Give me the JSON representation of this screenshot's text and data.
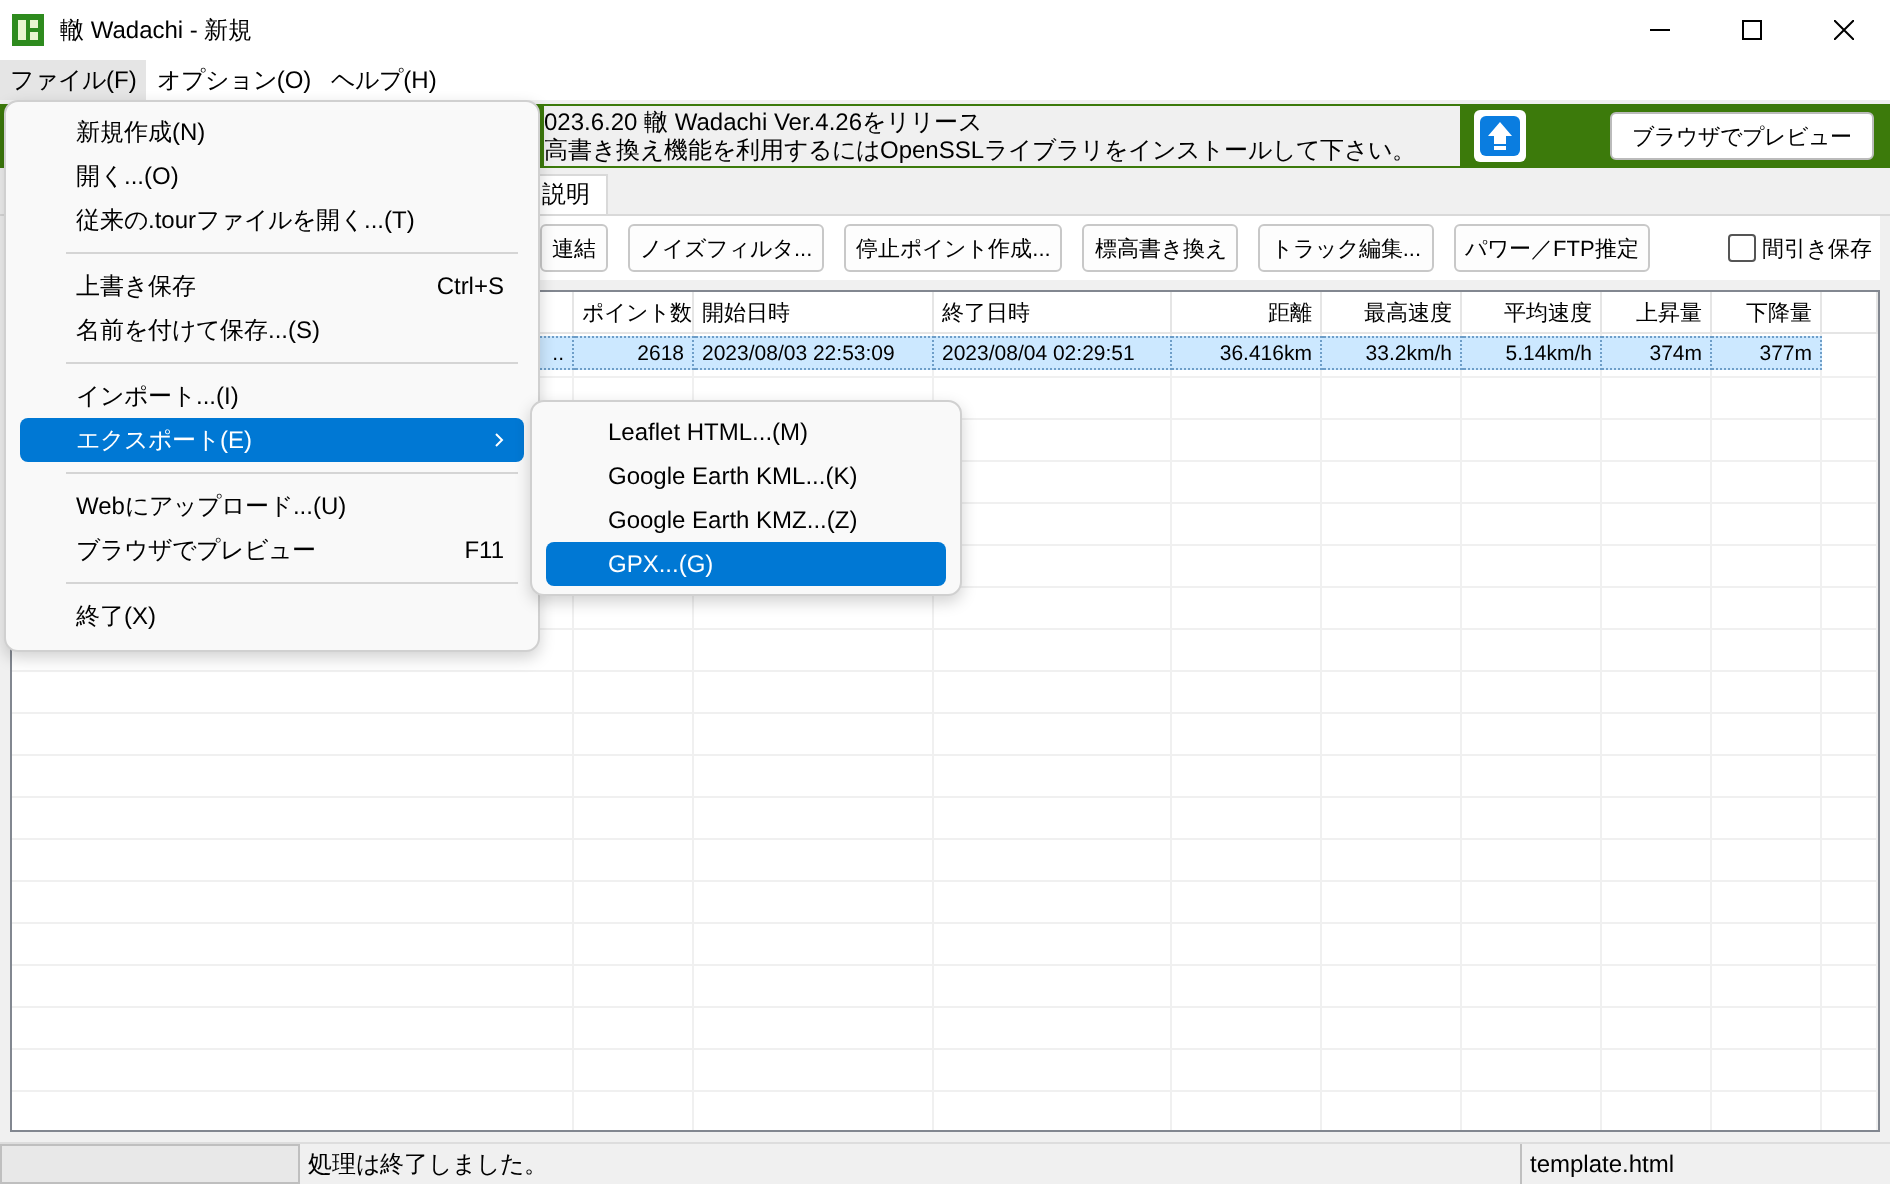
{
  "window": {
    "title": "轍 Wadachi - 新規"
  },
  "menubar": [
    {
      "label": "ファイル(F)",
      "selected": true
    },
    {
      "label": "オプション(O)",
      "selected": false
    },
    {
      "label": "ヘルプ(H)",
      "selected": false
    }
  ],
  "banner": {
    "lines": [
      "023.6.20 轍 Wadachi Ver.4.26をリリース",
      "高書き換え機能を利用するにはOpenSSLライブラリをインストールして下さい。"
    ],
    "preview_button": "ブラウザでプレビュー"
  },
  "tabs": [
    {
      "label": "説明",
      "selected": true
    }
  ],
  "toolbar": {
    "buttons": [
      "連結",
      "ノイズフィルタ...",
      "停止ポイント作成...",
      "標高書き換え",
      "トラック編集...",
      "パワー／FTP推定"
    ],
    "checkbox": {
      "label": "間引き保存",
      "checked": false
    }
  },
  "table": {
    "columns": [
      {
        "label": "ポイント数",
        "kind": "number"
      },
      {
        "label": "開始日時",
        "kind": "text"
      },
      {
        "label": "終了日時",
        "kind": "text"
      },
      {
        "label": "距離",
        "kind": "number"
      },
      {
        "label": "最高速度",
        "kind": "number"
      },
      {
        "label": "平均速度",
        "kind": "number"
      },
      {
        "label": "上昇量",
        "kind": "number"
      },
      {
        "label": "下降量",
        "kind": "number"
      }
    ],
    "rows": [
      {
        "selected": true,
        "column_1": "..",
        "cells": [
          "2618",
          "2023/08/03 22:53:09",
          "2023/08/04 02:29:51",
          "36.416km",
          "33.2km/h",
          "5.14km/h",
          "374m",
          "377m"
        ]
      }
    ]
  },
  "file_menu": [
    {
      "kind": "item",
      "label": "新規作成(N)",
      "selected": false
    },
    {
      "kind": "item",
      "label": "開く...(O)",
      "selected": false
    },
    {
      "kind": "item",
      "label": "従来の.tourファイルを開く...(T)",
      "selected": false
    },
    {
      "kind": "separator"
    },
    {
      "kind": "item",
      "label": "上書き保存",
      "shortcut": "Ctrl+S",
      "selected": false
    },
    {
      "kind": "item",
      "label": "名前を付けて保存...(S)",
      "selected": false
    },
    {
      "kind": "separator"
    },
    {
      "kind": "item",
      "label": "インポート...(I)",
      "selected": false
    },
    {
      "kind": "submenu",
      "label": "エクスポート(E)",
      "selected": true
    },
    {
      "kind": "separator"
    },
    {
      "kind": "item",
      "label": "Webにアップロード...(U)",
      "selected": false
    },
    {
      "kind": "item",
      "label": "ブラウザでプレビュー",
      "shortcut": "F11",
      "selected": false
    },
    {
      "kind": "separator"
    },
    {
      "kind": "item",
      "label": "終了(X)",
      "selected": false
    }
  ],
  "export_menu": [
    {
      "label": "Leaflet HTML...(M)",
      "selected": false
    },
    {
      "label": "Google Earth KML...(K)",
      "selected": false
    },
    {
      "label": "Google Earth KMZ...(Z)",
      "selected": false
    },
    {
      "label": "GPX...(G)",
      "selected": true
    }
  ],
  "status_bar": {
    "message": "処理は終了しました。",
    "file": "template.html"
  }
}
